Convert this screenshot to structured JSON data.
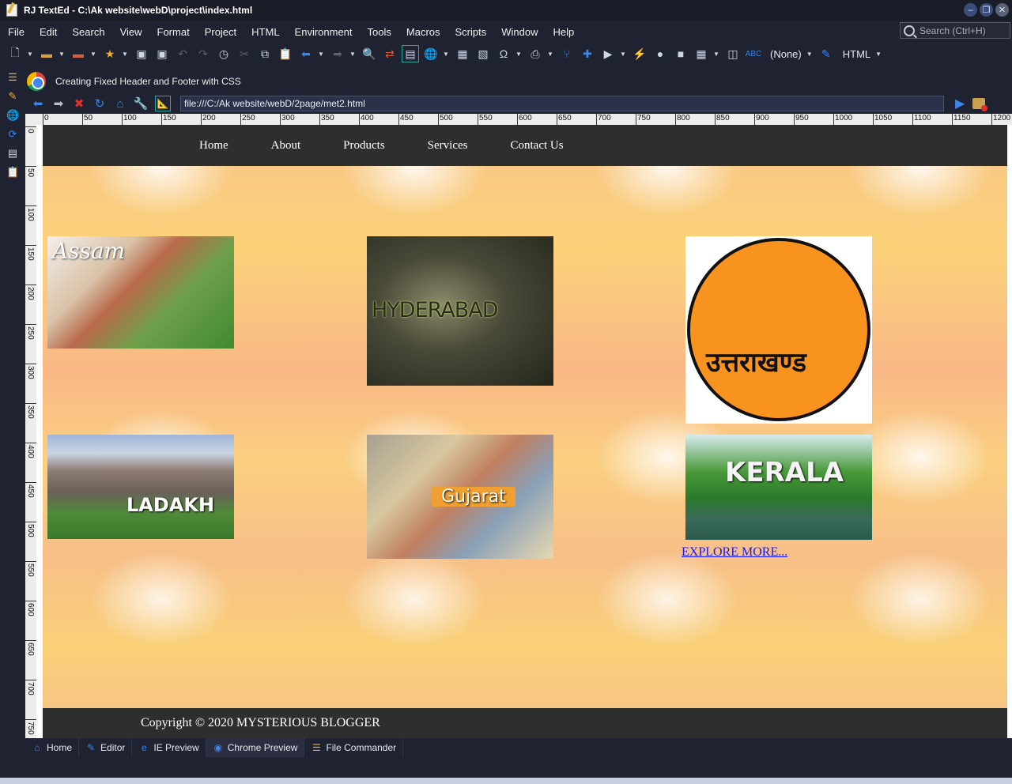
{
  "window": {
    "title": "RJ TextEd - C:\\Ak website\\webD\\project\\index.html"
  },
  "menu": [
    "File",
    "Edit",
    "Search",
    "View",
    "Format",
    "Project",
    "HTML",
    "Environment",
    "Tools",
    "Macros",
    "Scripts",
    "Window",
    "Help"
  ],
  "search": {
    "placeholder": "Search (Ctrl+H)"
  },
  "toolbar": {
    "syntax_label": "(None)",
    "language_label": "HTML"
  },
  "browser": {
    "tab_title": "Creating Fixed Header and Footer with CSS",
    "address": "file:///C:/Ak website/webD/2page/met2.html"
  },
  "ruler": {
    "h_ticks": [
      "0",
      "50",
      "100",
      "150",
      "200",
      "250",
      "300",
      "350",
      "400",
      "450",
      "500",
      "550",
      "600",
      "650",
      "700",
      "750",
      "800",
      "850",
      "900",
      "950",
      "1000",
      "1050",
      "1100",
      "1150",
      "1200"
    ],
    "v_ticks": [
      "0",
      "50",
      "100",
      "150",
      "200",
      "250",
      "300",
      "350",
      "400",
      "450",
      "500",
      "550",
      "600",
      "650",
      "700",
      "750"
    ]
  },
  "site": {
    "nav": [
      "Home",
      "About",
      "Products",
      "Services",
      "Contact Us"
    ],
    "tiles": [
      {
        "name": "tile-assam",
        "label": "Assam"
      },
      {
        "name": "tile-hyderabad",
        "label": "HYDERABAD"
      },
      {
        "name": "tile-uttarakhand",
        "label": "उत्तराखण्ड"
      },
      {
        "name": "tile-ladakh",
        "label": "LADAKH"
      },
      {
        "name": "tile-gujarat",
        "label": "Gujarat"
      },
      {
        "name": "tile-kerala",
        "label": "KERALA"
      }
    ],
    "explore_link": "EXPLORE MORE...",
    "footer": "Copyright © 2020 MYSTERIOUS BLOGGER"
  },
  "bottom_tabs": [
    "Home",
    "Editor",
    "IE Preview",
    "Chrome Preview",
    "File Commander"
  ],
  "colors": {
    "accent": "#2aa79a",
    "link": "#1a1aee",
    "header_bg": "#2e2e2e",
    "app_bg": "#1f2230"
  }
}
